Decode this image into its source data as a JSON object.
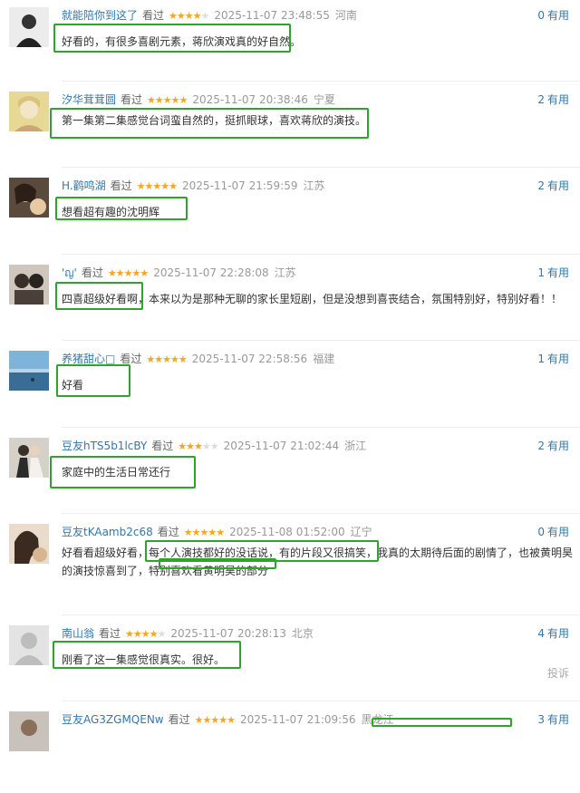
{
  "comments": [
    {
      "user": "就能陪你到这了",
      "status": "看过",
      "stars": 4,
      "time": "2025-11-07 23:48:55",
      "location": "河南",
      "useful_count": "0",
      "useful_label": "有用",
      "content": "好看的，有很多喜剧元素，蒋欣演戏真的好自然。"
    },
    {
      "user": "汐华茸茸圆",
      "status": "看过",
      "stars": 5,
      "time": "2025-11-07 20:38:46",
      "location": "宁夏",
      "useful_count": "2",
      "useful_label": "有用",
      "content": "第一集第二集感觉台词蛮自然的，挺抓眼球，喜欢蒋欣的演技。"
    },
    {
      "user": "H.鹳鸣湖",
      "status": "看过",
      "stars": 5,
      "time": "2025-11-07 21:59:59",
      "location": "江苏",
      "useful_count": "2",
      "useful_label": "有用",
      "content": "想看超有趣的沈明辉"
    },
    {
      "user": "'ญ'",
      "status": "看过",
      "stars": 5,
      "time": "2025-11-07 22:28:08",
      "location": "江苏",
      "useful_count": "1",
      "useful_label": "有用",
      "content": "四喜超级好看啊，本来以为是那种无聊的家长里短剧，但是没想到喜丧结合，氛围特别好，特别好看！！"
    },
    {
      "user": "养猪甜心□",
      "status": "看过",
      "stars": 5,
      "time": "2025-11-07 22:58:56",
      "location": "福建",
      "useful_count": "1",
      "useful_label": "有用",
      "content": "好看"
    },
    {
      "user": "豆友hTS5b1lcBY",
      "status": "看过",
      "stars": 3,
      "time": "2025-11-07 21:02:44",
      "location": "浙江",
      "useful_count": "2",
      "useful_label": "有用",
      "content": "家庭中的生活日常还行"
    },
    {
      "user": "豆友tKAamb2c68",
      "status": "看过",
      "stars": 5,
      "time": "2025-11-08 01:52:00",
      "location": "辽宁",
      "useful_count": "0",
      "useful_label": "有用",
      "content": "好看看超级好看，每个人演技都好的没话说，有的片段又很搞笑，我真的太期待后面的剧情了，也被黄明昊的演技惊喜到了，特别喜欢看黄明昊的部分"
    },
    {
      "user": "南山翁",
      "status": "看过",
      "stars": 4,
      "time": "2025-11-07 20:28:13",
      "location": "北京",
      "useful_count": "4",
      "useful_label": "有用",
      "content": "刚看了这一集感觉很真实。很好。",
      "report": "投诉"
    },
    {
      "user": "豆友AG3ZGMQENw",
      "status": "看过",
      "stars": 5,
      "time": "2025-11-07 21:09:56",
      "location": "黑龙江",
      "useful_count": "3",
      "useful_label": "有用",
      "content": ""
    }
  ],
  "colors": {
    "highlight": "#2ea52a",
    "link": "#3377aa",
    "star": "#f5a623"
  }
}
